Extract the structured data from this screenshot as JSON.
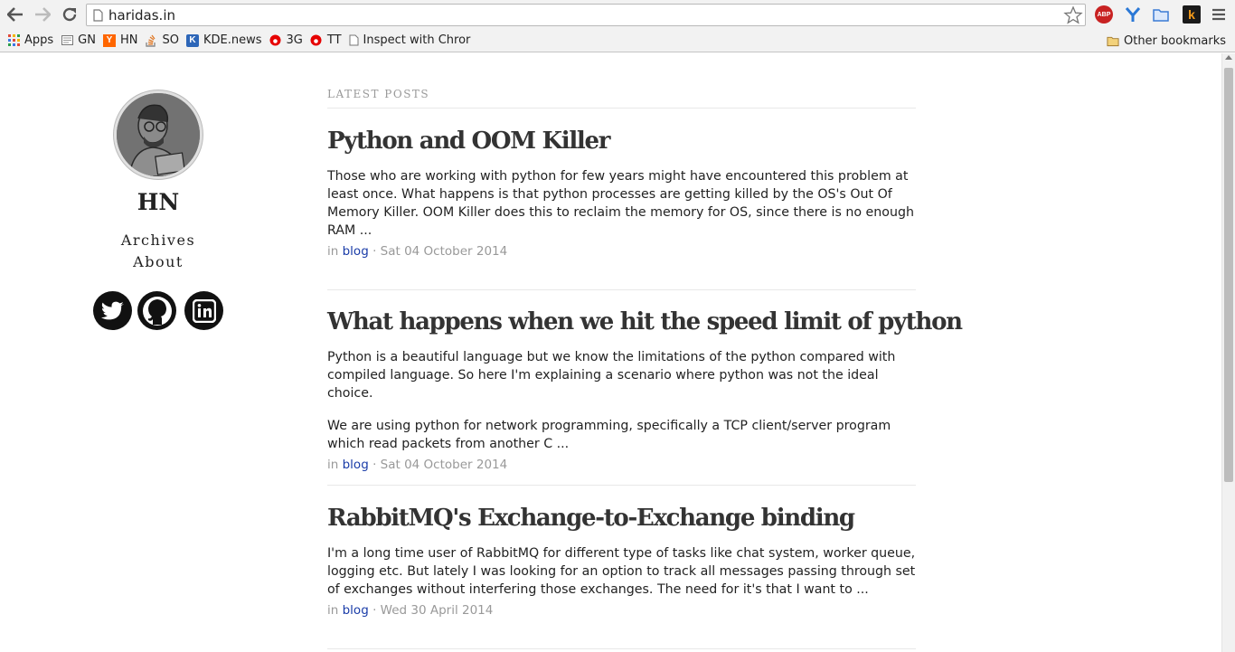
{
  "browser": {
    "url": "haridas.in",
    "bookmarks": [
      {
        "label": "Apps",
        "icon": "apps-grid-icon"
      },
      {
        "label": "GN",
        "icon": "news-icon"
      },
      {
        "label": "HN",
        "icon": "hacker-news-icon"
      },
      {
        "label": "SO",
        "icon": "stackoverflow-icon"
      },
      {
        "label": "KDE.news",
        "icon": "kde-icon"
      },
      {
        "label": "3G",
        "icon": "vodafone-icon"
      },
      {
        "label": "TT",
        "icon": "vodafone-icon"
      },
      {
        "label": "Inspect with Chror",
        "icon": "page-icon"
      }
    ],
    "other_bookmarks": "Other bookmarks",
    "extensions": {
      "abp": "ABP",
      "k": "k"
    }
  },
  "sidebar": {
    "site_name": "HN",
    "links": [
      "Archives",
      "About"
    ],
    "social": [
      "twitter-icon",
      "github-icon",
      "linkedin-icon"
    ]
  },
  "main": {
    "section_label": "LATEST POSTS",
    "posts": [
      {
        "title": "Python and OOM Killer",
        "paragraphs": [
          "Those who are working with python for few years might have encountered this problem at least once. What happens is that python processes are getting killed by the OS's Out Of Memory Killer. OOM Killer does this to reclaim the memory for OS, since there is no enough RAM ..."
        ],
        "meta_prefix": "in",
        "category": "blog",
        "date": "· Sat 04 October 2014"
      },
      {
        "title": "What happens when we hit the speed limit of python",
        "paragraphs": [
          "Python is a beautiful language but we know the limitations of the python compared with compiled language. So here I'm explaining a scenario where python was not the ideal choice.",
          "We are using python for network programming, specifically a TCP client/server program which read packets from another C ..."
        ],
        "meta_prefix": "in",
        "category": "blog",
        "date": "· Sat 04 October 2014"
      },
      {
        "title": "RabbitMQ's Exchange-to-Exchange binding",
        "paragraphs": [
          "I'm a long time user of RabbitMQ for different type of tasks like chat system, worker queue, logging etc. But lately I was looking for an option to track all messages passing through set of exchanges without interfering those exchanges. The need for it's that I want to ..."
        ],
        "meta_prefix": "in",
        "category": "blog",
        "date": "· Wed 30 April 2014"
      }
    ]
  }
}
